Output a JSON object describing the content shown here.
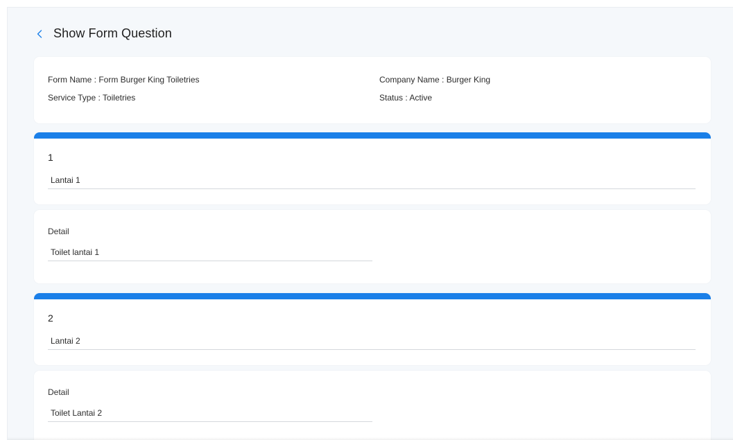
{
  "header": {
    "title": "Show Form Question",
    "back_icon": "chevron-left-icon",
    "accent_color": "#1a7fe8"
  },
  "info": {
    "form_name": "Form Name : Form Burger King Toiletries",
    "service_type": "Service Type : Toiletries",
    "company_name": "Company Name : Burger King",
    "status": "Status : Active"
  },
  "questions": [
    {
      "number": "1",
      "answer": "Lantai 1",
      "detail_label": "Detail",
      "detail_value": "Toilet lantai 1"
    },
    {
      "number": "2",
      "answer": "Lantai 2",
      "detail_label": "Detail",
      "detail_value": "Toilet Lantai 2"
    }
  ]
}
